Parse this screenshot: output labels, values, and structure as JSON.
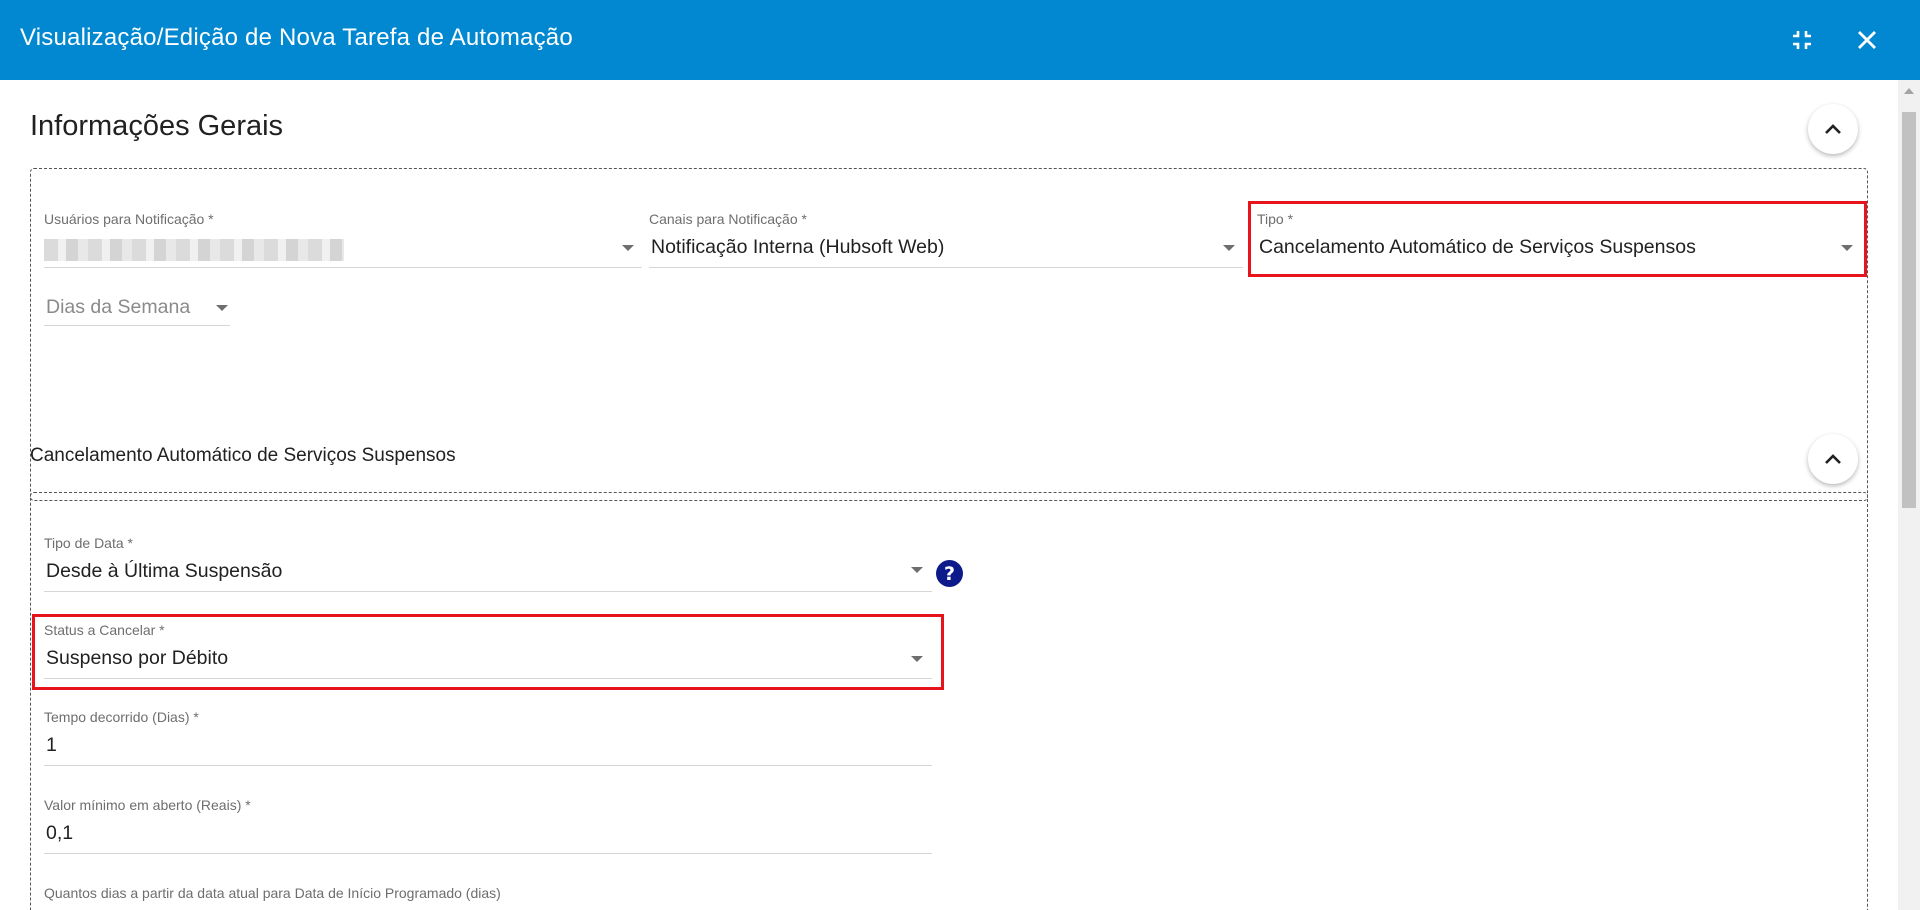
{
  "window": {
    "title": "Visualização/Edição de Nova Tarefa de Automação",
    "icons": {
      "compress": "compress-icon",
      "close": "close-icon"
    }
  },
  "general": {
    "title": "Informações Gerais",
    "fields": {
      "usuarios": {
        "label": "Usuários para Notificação *",
        "value": ""
      },
      "canais": {
        "label": "Canais para Notificação *",
        "value": "Notificação Interna (Hubsoft Web)"
      },
      "tipo": {
        "label": "Tipo *",
        "value": "Cancelamento Automático de Serviços Suspensos"
      },
      "dias": {
        "placeholder": "Dias da Semana"
      }
    }
  },
  "cancel_section": {
    "title": "Cancelamento Automático de Serviços Suspensos",
    "fields": {
      "tipo_data": {
        "label": "Tipo de Data *",
        "value": "Desde à Última Suspensão",
        "help": "?"
      },
      "status": {
        "label": "Status a Cancelar *",
        "value": "Suspenso por Débito"
      },
      "tempo": {
        "label": "Tempo decorrido (Dias) *",
        "value": "1"
      },
      "valor": {
        "label": "Valor mínimo em aberto (Reais) *",
        "value": "0,1"
      },
      "quantos_dias": {
        "label": "Quantos dias a partir da data atual para Data de Início Programado (dias)"
      }
    }
  },
  "colors": {
    "header": "#0288d1",
    "highlight": "#e8141c",
    "help": "#0d1a8a"
  }
}
